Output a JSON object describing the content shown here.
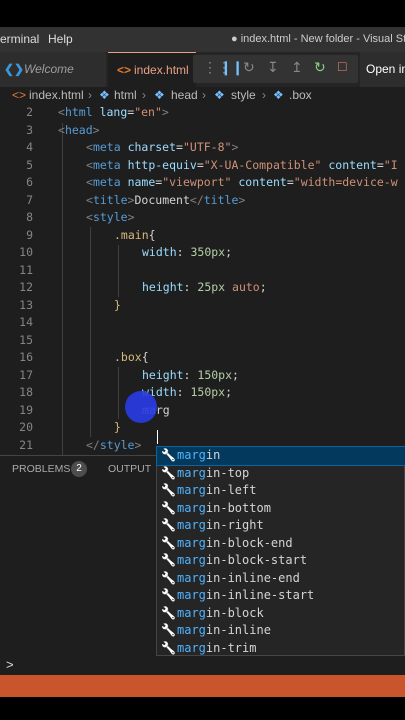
{
  "titlebar": {
    "menus": [
      "erminal",
      "Help"
    ],
    "window_title": "● index.html - New folder - Visual St"
  },
  "tabs": [
    {
      "label": "Welcome",
      "icon": "vscode-logo-icon"
    },
    {
      "label": "index.html",
      "icon": "html-file-icon"
    }
  ],
  "debug_toolbar": {
    "buttons": [
      "grip-icon",
      "pause-icon",
      "step-over-icon",
      "step-into-icon",
      "step-out-icon",
      "restart-icon",
      "stop-icon"
    ],
    "open_in_label": "Open in"
  },
  "breadcrumb": [
    "index.html",
    "html",
    "head",
    "style",
    ".box"
  ],
  "editor": {
    "lines": [
      {
        "n": "2",
        "tokens": [
          {
            "t": "<",
            "c": "punc"
          },
          {
            "t": "html",
            "c": "tag"
          },
          {
            "t": " lang",
            "c": "attr"
          },
          {
            "t": "=",
            "c": "plain"
          },
          {
            "t": "\"en\"",
            "c": "str"
          },
          {
            "t": ">",
            "c": "punc"
          }
        ],
        "indent": 0
      },
      {
        "n": "3",
        "tokens": [
          {
            "t": "<",
            "c": "punc"
          },
          {
            "t": "head",
            "c": "tag"
          },
          {
            "t": ">",
            "c": "punc"
          }
        ],
        "indent": 0
      },
      {
        "n": "4",
        "tokens": [
          {
            "t": "<",
            "c": "punc"
          },
          {
            "t": "meta",
            "c": "tag"
          },
          {
            "t": " charset",
            "c": "attr"
          },
          {
            "t": "=",
            "c": "plain"
          },
          {
            "t": "\"UTF-8\"",
            "c": "str"
          },
          {
            "t": ">",
            "c": "punc"
          }
        ],
        "indent": 1
      },
      {
        "n": "5",
        "tokens": [
          {
            "t": "<",
            "c": "punc"
          },
          {
            "t": "meta",
            "c": "tag"
          },
          {
            "t": " http-equiv",
            "c": "attr"
          },
          {
            "t": "=",
            "c": "plain"
          },
          {
            "t": "\"X-UA-Compatible\"",
            "c": "str"
          },
          {
            "t": " content",
            "c": "attr"
          },
          {
            "t": "=",
            "c": "plain"
          },
          {
            "t": "\"I",
            "c": "str"
          }
        ],
        "indent": 1
      },
      {
        "n": "6",
        "tokens": [
          {
            "t": "<",
            "c": "punc"
          },
          {
            "t": "meta",
            "c": "tag"
          },
          {
            "t": " name",
            "c": "attr"
          },
          {
            "t": "=",
            "c": "plain"
          },
          {
            "t": "\"viewport\"",
            "c": "str"
          },
          {
            "t": " content",
            "c": "attr"
          },
          {
            "t": "=",
            "c": "plain"
          },
          {
            "t": "\"width=device-w",
            "c": "str"
          }
        ],
        "indent": 1
      },
      {
        "n": "7",
        "tokens": [
          {
            "t": "<",
            "c": "punc"
          },
          {
            "t": "title",
            "c": "tag"
          },
          {
            "t": ">",
            "c": "punc"
          },
          {
            "t": "Document",
            "c": "plain"
          },
          {
            "t": "</",
            "c": "punc"
          },
          {
            "t": "title",
            "c": "tag"
          },
          {
            "t": ">",
            "c": "punc"
          }
        ],
        "indent": 1
      },
      {
        "n": "8",
        "tokens": [
          {
            "t": "<",
            "c": "punc"
          },
          {
            "t": "style",
            "c": "tag"
          },
          {
            "t": ">",
            "c": "punc"
          }
        ],
        "indent": 1
      },
      {
        "n": "9",
        "tokens": [
          {
            "t": ".main",
            "c": "sel"
          },
          {
            "t": "{",
            "c": "plain"
          }
        ],
        "indent": 2
      },
      {
        "n": "10",
        "tokens": [
          {
            "t": "width",
            "c": "prop"
          },
          {
            "t": ": ",
            "c": "plain"
          },
          {
            "t": "350px",
            "c": "val"
          },
          {
            "t": ";",
            "c": "plain"
          }
        ],
        "indent": 3
      },
      {
        "n": "11",
        "tokens": [],
        "indent": 0
      },
      {
        "n": "12",
        "tokens": [
          {
            "t": "height",
            "c": "prop"
          },
          {
            "t": ": ",
            "c": "plain"
          },
          {
            "t": "25px",
            "c": "val"
          },
          {
            "t": " auto",
            "c": "str"
          },
          {
            "t": ";",
            "c": "plain"
          }
        ],
        "indent": 3
      },
      {
        "n": "13",
        "tokens": [
          {
            "t": "}",
            "c": "sel"
          }
        ],
        "indent": 2
      },
      {
        "n": "14",
        "tokens": [],
        "indent": 0
      },
      {
        "n": "15",
        "tokens": [],
        "indent": 0
      },
      {
        "n": "16",
        "tokens": [
          {
            "t": ".box",
            "c": "sel"
          },
          {
            "t": "{",
            "c": "plain"
          }
        ],
        "indent": 2
      },
      {
        "n": "17",
        "tokens": [
          {
            "t": "height",
            "c": "prop"
          },
          {
            "t": ": ",
            "c": "plain"
          },
          {
            "t": "150px",
            "c": "val"
          },
          {
            "t": ";",
            "c": "plain"
          }
        ],
        "indent": 3
      },
      {
        "n": "18",
        "tokens": [
          {
            "t": "width",
            "c": "prop"
          },
          {
            "t": ": ",
            "c": "plain"
          },
          {
            "t": "150px",
            "c": "val"
          },
          {
            "t": ";",
            "c": "plain"
          }
        ],
        "indent": 3
      },
      {
        "n": "19",
        "tokens": [
          {
            "t": "marg",
            "c": "plain"
          }
        ],
        "indent": 3
      },
      {
        "n": "20",
        "tokens": [
          {
            "t": "}",
            "c": "sel"
          }
        ],
        "indent": 2
      },
      {
        "n": "21",
        "tokens": [
          {
            "t": "</",
            "c": "punc"
          },
          {
            "t": "style",
            "c": "tag"
          },
          {
            "t": ">",
            "c": "punc"
          }
        ],
        "indent": 1
      }
    ]
  },
  "panel": {
    "tabs": [
      "PROBLEMS",
      "OUTPUT"
    ],
    "problem_count": "2",
    "terminal_prompt": ">"
  },
  "suggestions": {
    "typed": "marg",
    "items": [
      "margin",
      "margin-top",
      "margin-left",
      "margin-bottom",
      "margin-right",
      "margin-block-end",
      "margin-block-start",
      "margin-inline-end",
      "margin-inline-start",
      "margin-block",
      "margin-inline",
      "margin-trim"
    ],
    "selected_index": 0,
    "item_icon": "wrench-icon"
  },
  "colors": {
    "status_bar": "#c9552c",
    "selection": "#04395e",
    "cursor_highlight": "#283ce6"
  }
}
